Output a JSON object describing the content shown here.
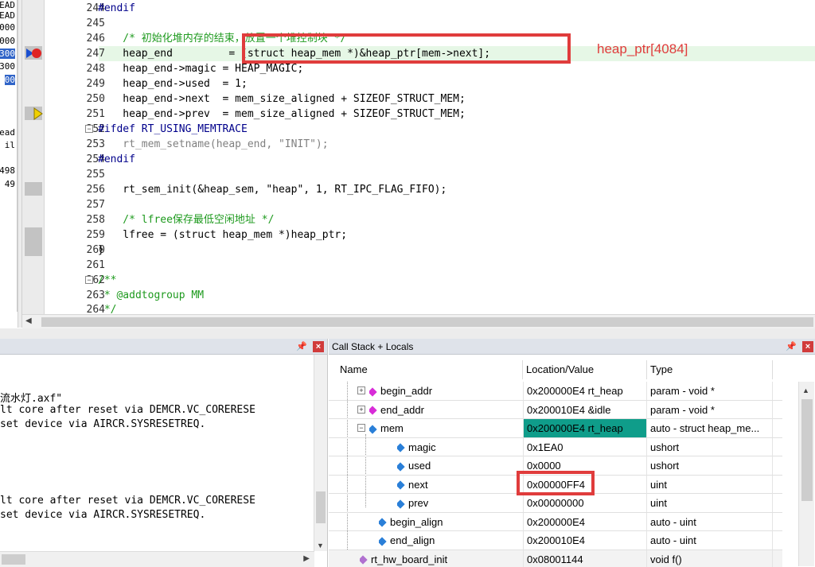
{
  "left_strip": [
    "EAD",
    "EAD",
    "000",
    "000",
    "300",
    "300",
    "00",
    "",
    "",
    "ead",
    "il",
    "",
    "498",
    "49"
  ],
  "editor": {
    "lines": [
      {
        "num": "244",
        "text": "#endif"
      },
      {
        "num": "245",
        "text": ""
      },
      {
        "num": "246",
        "text": "    /* 初始化堆内存的结束，放置一个堆控制块 */"
      },
      {
        "num": "247",
        "text": "    heap_end         = (struct heap_mem *)&heap_ptr[mem->next];"
      },
      {
        "num": "248",
        "text": "    heap_end->magic = HEAP_MAGIC;"
      },
      {
        "num": "249",
        "text": "    heap_end->used  = 1;"
      },
      {
        "num": "250",
        "text": "    heap_end->next  = mem_size_aligned + SIZEOF_STRUCT_MEM;"
      },
      {
        "num": "251",
        "text": "    heap_end->prev  = mem_size_aligned + SIZEOF_STRUCT_MEM;"
      },
      {
        "num": "252",
        "text": "#ifdef RT_USING_MEMTRACE"
      },
      {
        "num": "253",
        "text": "    rt_mem_setname(heap_end, \"INIT\");"
      },
      {
        "num": "254",
        "text": "#endif"
      },
      {
        "num": "255",
        "text": ""
      },
      {
        "num": "256",
        "text": "    rt_sem_init(&heap_sem, \"heap\", 1, RT_IPC_FLAG_FIFO);"
      },
      {
        "num": "257",
        "text": ""
      },
      {
        "num": "258",
        "text": "    /* lfree保存最低空闲地址 */"
      },
      {
        "num": "259",
        "text": "    lfree = (struct heap_mem *)heap_ptr;"
      },
      {
        "num": "260",
        "text": "}"
      },
      {
        "num": "261",
        "text": ""
      },
      {
        "num": "262",
        "text": "/**"
      },
      {
        "num": "263",
        "text": " * @addtogroup MM"
      },
      {
        "num": "264",
        "text": " */"
      }
    ],
    "annotation": "heap_ptr[4084]"
  },
  "build_output": {
    "lines": [
      "流水灯.axf\"",
      "lt core after reset via DEMCR.VC_CORERESE",
      "set device via AIRCR.SYSRESETREQ.",
      "",
      "",
      "",
      "lt core after reset via DEMCR.VC_CORERESE",
      "set device via AIRCR.SYSRESETREQ.",
      ""
    ]
  },
  "callstack": {
    "title": "Call Stack + Locals",
    "columns": [
      "Name",
      "Location/Value",
      "Type"
    ],
    "rows": [
      {
        "name": "begin_addr",
        "value": "0x200000E4 rt_heap",
        "type": "param - void *"
      },
      {
        "name": "end_addr",
        "value": "0x200010E4 &idle",
        "type": "param - void *"
      },
      {
        "name": "mem",
        "value": "0x200000E4 rt_heap",
        "type": "auto - struct heap_me..."
      },
      {
        "name": "magic",
        "value": "0x1EA0",
        "type": "ushort"
      },
      {
        "name": "used",
        "value": "0x0000",
        "type": "ushort"
      },
      {
        "name": "next",
        "value": "0x00000FF4",
        "type": "uint"
      },
      {
        "name": "prev",
        "value": "0x00000000",
        "type": "uint"
      },
      {
        "name": "begin_align",
        "value": "0x200000E4",
        "type": "auto - uint"
      },
      {
        "name": "end_align",
        "value": "0x200010E4",
        "type": "auto - uint"
      },
      {
        "name": "rt_hw_board_init",
        "value": "0x08001144",
        "type": "void f()"
      }
    ]
  },
  "icons": {
    "pin": "pin-icon",
    "close": "close-icon",
    "breakpoint": "breakpoint-icon",
    "current_arrow": "current-line-arrow-icon"
  },
  "colors": {
    "accent_red": "#e03c3c",
    "selection": "#0f9d8a",
    "comment_green": "#1e9a1e",
    "keyword_blue": "#0000ff"
  }
}
